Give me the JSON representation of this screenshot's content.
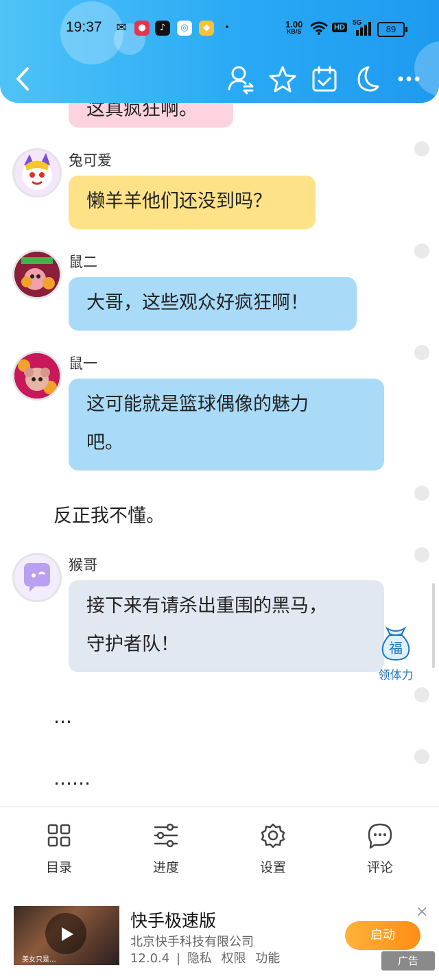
{
  "status_bar": {
    "time": "19:37",
    "net_speed_value": "1.00",
    "net_speed_unit": "KB/S",
    "hd": "HD",
    "signal_label": "5G",
    "battery": "89"
  },
  "top_partial_message": "这真疯狂啊。",
  "messages": [
    {
      "speaker": "兔可爱",
      "text_line1": "懒羊羊他们还没到吗？",
      "bubble_color": "#fde287"
    },
    {
      "speaker": "鼠二",
      "text_line1": "大哥，这些观众好疯狂啊！",
      "bubble_color": "#a9dbf8"
    },
    {
      "speaker": "鼠一",
      "text_line1": "这可能就是篮球偶像的魅力",
      "text_line2": "吧。",
      "bubble_color": "#a9dbf8"
    },
    {
      "speaker": "猴哥",
      "text_line1": "接下来有请杀出重围的黑马，",
      "text_line2": "守护者队！",
      "bubble_color": "#e2e8f1"
    }
  ],
  "narration": [
    "反正我不懂。",
    "…",
    "……"
  ],
  "reward": {
    "icon_char": "福",
    "label": "领体力"
  },
  "bottom_nav": [
    {
      "label": "目录",
      "icon": "grid-icon"
    },
    {
      "label": "进度",
      "icon": "sliders-icon"
    },
    {
      "label": "设置",
      "icon": "gear-icon"
    },
    {
      "label": "评论",
      "icon": "comment-icon"
    }
  ],
  "ad": {
    "title": "快手极速版",
    "company": "北京快手科技有限公司",
    "version": "12.0.4",
    "sep": "|",
    "privacy": "隐私",
    "permissions": "权限",
    "features": "功能",
    "button": "启动",
    "tag": "广告",
    "close": "×",
    "thumb_caption": "美女只是..."
  },
  "colors": {
    "header": "#29a9f5",
    "pink_bubble": "#fcd3de",
    "accent_link": "#1f76c0"
  }
}
